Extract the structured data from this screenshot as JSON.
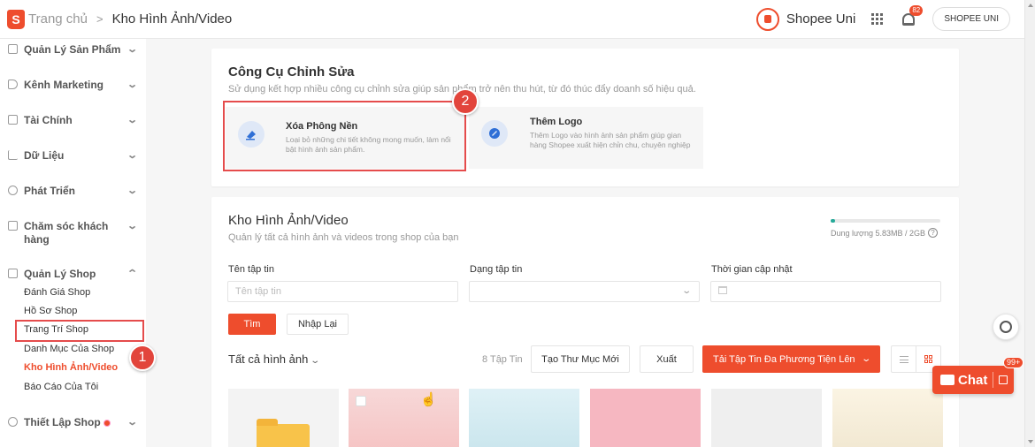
{
  "header": {
    "logo_letter": "S",
    "breadcrumb_home": "Trang chủ",
    "breadcrumb_sep": ">",
    "breadcrumb_current": "Kho Hình Ảnh/Video",
    "uni_label": "Shopee Uni",
    "notification_count": "82",
    "shop_button": "SHOPEE UNI"
  },
  "sidebar": {
    "items": [
      {
        "label": "Quản Lý Sản Phẩm",
        "icon": "product-icon"
      },
      {
        "label": "Kênh Marketing",
        "icon": "tag-icon"
      },
      {
        "label": "Tài Chính",
        "icon": "wallet-icon"
      },
      {
        "label": "Dữ Liệu",
        "icon": "chart-icon"
      },
      {
        "label": "Phát Triển",
        "icon": "growth-icon"
      },
      {
        "label": "Chăm sóc khách hàng",
        "icon": "chat-icon"
      },
      {
        "label": "Quản Lý Shop",
        "icon": "shop-icon"
      },
      {
        "label": "Thiết Lập Shop",
        "icon": "settings-icon"
      }
    ],
    "sub_items": [
      "Đánh Giá Shop",
      "Hồ Sơ Shop",
      "Trang Trí Shop",
      "Danh Mục Của Shop",
      "Kho Hình Ảnh/Video",
      "Báo Cáo Của Tôi"
    ],
    "step1": "1",
    "collapse_chevron": "⌄",
    "expand_chevron": "⌃"
  },
  "tools": {
    "title": "Công Cụ Chỉnh Sửa",
    "subtitle": "Sử dụng kết hợp nhiều công cụ chỉnh sửa giúp sản phẩm trở nên thu hút, từ đó thúc đẩy doanh số hiệu quả.",
    "step2": "2",
    "items": [
      {
        "name": "Xóa Phông Nền",
        "desc": "Loại bỏ những chi tiết không mong muốn, làm nổi bật hình ảnh sản phẩm."
      },
      {
        "name": "Thêm Logo",
        "desc": "Thêm Logo vào hình ảnh sản phẩm giúp gian hàng Shopee xuất hiện chỉn chu, chuyên nghiệp"
      }
    ]
  },
  "library": {
    "title": "Kho Hình Ảnh/Video",
    "subtitle": "Quản lý tất cả hình ảnh và videos trong shop của bạn",
    "storage_text": "Dung lượng 5.83MB / 2GB",
    "storage_fraction": 0.003,
    "help_mark": "?",
    "filters": {
      "name_label": "Tên tập tin",
      "name_placeholder": "Tên tập tin",
      "type_label": "Dạng tập tin",
      "type_value": "",
      "time_label": "Thời gian cập nhật"
    },
    "search_button": "Tìm",
    "reset_button": "Nhập Lại",
    "all_images": "Tất cả hình ảnh",
    "file_count": "8 Tập Tin",
    "new_folder_button": "Tạo Thư Mục Mới",
    "export_button": "Xuất",
    "upload_button": "Tải Tập Tin Đa Phương Tiện Lên",
    "dropdown_chevron": "⌄"
  },
  "chat": {
    "label": "Chat",
    "badge": "99+"
  },
  "colors": {
    "brand": "#ee4d2d",
    "highlight": "#e54c4c",
    "storage": "#26aa99"
  }
}
